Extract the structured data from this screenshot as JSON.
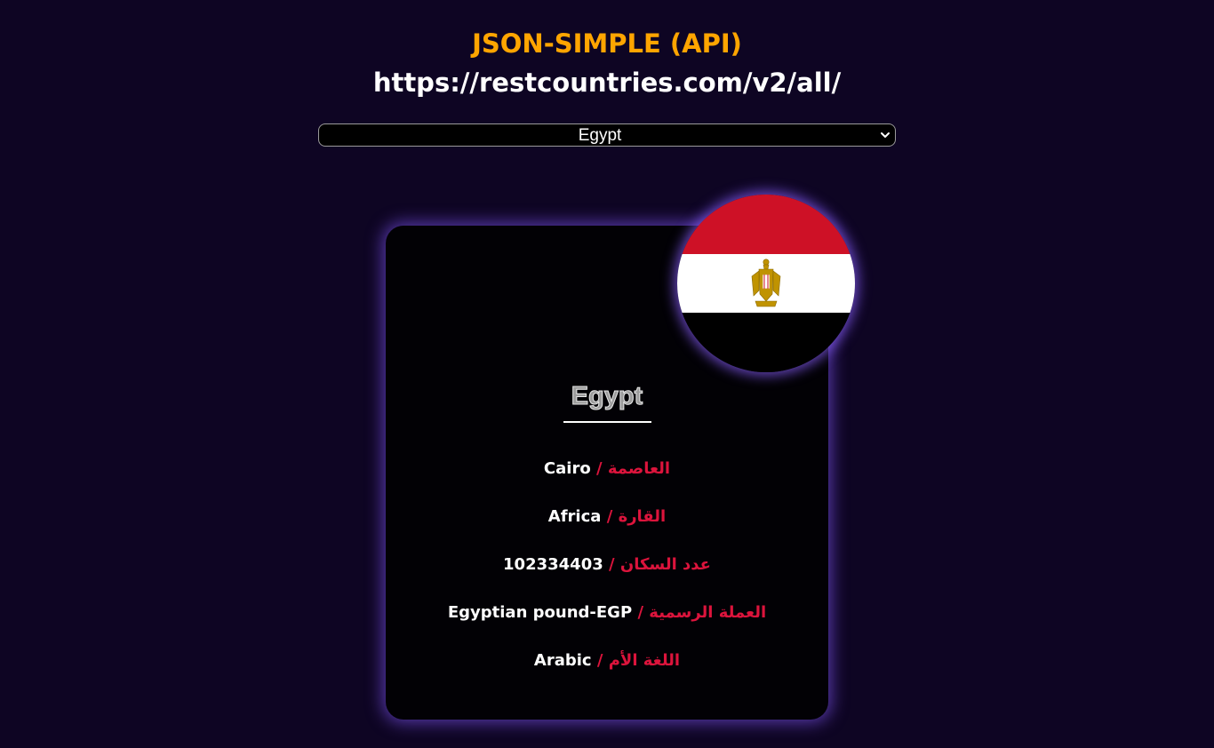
{
  "header": {
    "title": "JSON-SIMPLE (API)",
    "url": "https://restcountries.com/v2/all/"
  },
  "select": {
    "selected": "Egypt",
    "options": [
      "Egypt"
    ]
  },
  "country": {
    "name": "Egypt",
    "flag_icon": "egypt-flag",
    "flag_colors": [
      "#ce1126",
      "#ffffff",
      "#000000"
    ],
    "rows": [
      {
        "value": "Cairo",
        "separator": "/",
        "label": "العاصمة"
      },
      {
        "value": "Africa",
        "separator": "/",
        "label": "القارة"
      },
      {
        "value": "102334403",
        "separator": "/",
        "label": "عدد السكان"
      },
      {
        "value": "Egyptian pound-EGP",
        "separator": "/",
        "label": "العملة الرسمية"
      },
      {
        "value": "Arabic",
        "separator": "/",
        "label": "اللغة الأم"
      }
    ]
  },
  "colors": {
    "background": "#0e0523",
    "title": "#ffa500",
    "accent_label": "#dc143c",
    "card": "#020105",
    "glow": "#7850e6"
  }
}
